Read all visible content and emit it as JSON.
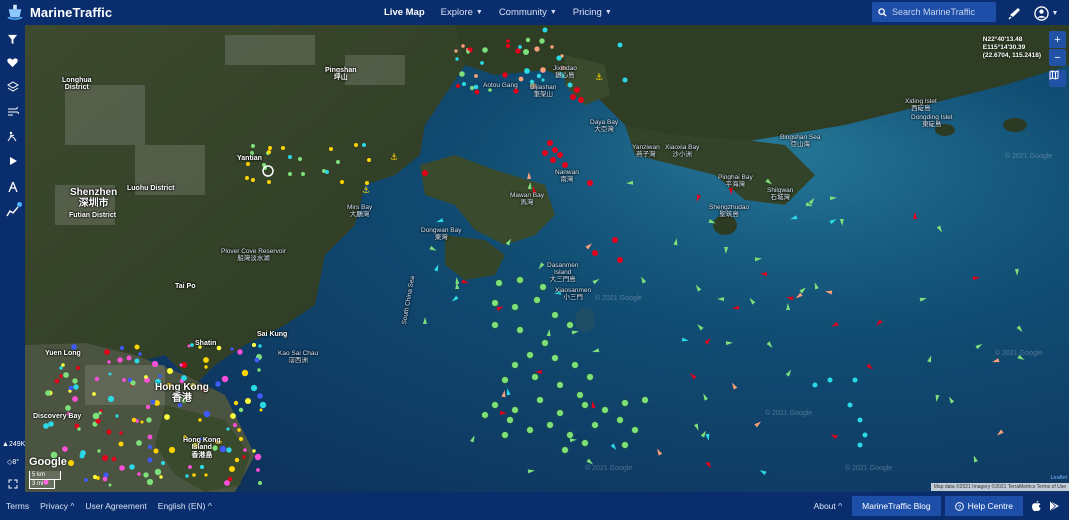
{
  "header": {
    "brand": "MarineTraffic",
    "nav": [
      {
        "label": "Live Map",
        "active": true
      },
      {
        "label": "Explore",
        "active": false
      },
      {
        "label": "Community",
        "active": false
      },
      {
        "label": "Pricing",
        "active": false
      }
    ],
    "search_placeholder": "Search MarineTraffic"
  },
  "sidebar": {
    "buttons": [
      "filter-icon",
      "heart-icon",
      "layers-icon",
      "weather-icon",
      "density-icon",
      "play-icon",
      "ruler-icon",
      "trend-icon"
    ],
    "vessel_count": "249K",
    "angle": "8°"
  },
  "map": {
    "coordinates": {
      "lat": "N22°40'13.48",
      "lon": "E115°14'30.39",
      "decimal": "(22.6704, 115.2418)"
    },
    "places": [
      {
        "name": "Shenzhen\n深圳市"
      },
      {
        "name": "Hong Kong\n香港"
      },
      {
        "name": "Hong Kong\nIsland\n香港島"
      },
      {
        "name": "Mirs Bay\n大鵬灣"
      },
      {
        "name": "Daya Bay\n大亞灣"
      },
      {
        "name": "Dasanmen\nIsland\n大三門島"
      },
      {
        "name": "Xiaosanmen\n小三門"
      },
      {
        "name": "Jixindao\n雞心島"
      },
      {
        "name": "Bijiashan\n筆架山"
      },
      {
        "name": "Nanwan\n南灣"
      },
      {
        "name": "Mawan Bay\n馬灣"
      },
      {
        "name": "Dongwan Bay\n東灣"
      },
      {
        "name": "Xiding Islet\n西碇島"
      },
      {
        "name": "Dongding Islet\n東碇島"
      },
      {
        "name": "Shengzhudao\n聖筑島"
      },
      {
        "name": "Pinghai Bay\n平海灣"
      },
      {
        "name": "Shilgwan\n石城灣"
      },
      {
        "name": "Bingshan Sea\n亞山海"
      },
      {
        "name": "Kao Sai Chau\n滘西洲"
      },
      {
        "name": "Plover Cove Reservoir\n船灣淡水湖"
      },
      {
        "name": "Yanziwan\n燕子灣"
      },
      {
        "name": "Xiaoxia Bay\n沙小洲"
      },
      {
        "name": "Pingshan\n坪山"
      },
      {
        "name": "Tai Po"
      },
      {
        "name": "Sai Kung"
      },
      {
        "name": "Longhua\nDistrict"
      },
      {
        "name": "Luohu District"
      },
      {
        "name": "Futian District"
      },
      {
        "name": "Yantian"
      },
      {
        "name": "Aotou Gang"
      },
      {
        "name": "South China Sea"
      },
      {
        "name": "Discovery Bay"
      },
      {
        "name": "Yuen Long"
      },
      {
        "name": "Shatin"
      }
    ],
    "watermark": "© 2021 Google",
    "google_logo": "Google",
    "scale_km": "5 km",
    "scale_mi": "3 mi",
    "attribution": "Map data ©2021 Imagery ©2021 TerraMetrics  Terms of Use",
    "leaflet": "Leaflet"
  },
  "footer": {
    "links_left": [
      "Terms",
      "Privacy ^",
      "User Agreement",
      "English (EN) ^"
    ],
    "about": "About ^",
    "blog": "MarineTraffic Blog",
    "help": "Help Centre"
  },
  "colors": {
    "nav_bg": "#0a2d6e",
    "accent": "#1e4fa8",
    "cargo": "#7ee07a",
    "tanker": "#e3001b",
    "passenger": "#2bd9e6",
    "fishing": "#ffa07a",
    "tug": "#ffd400",
    "pleasure": "#ff4fd8",
    "unknown": "#b0b0b0",
    "hsc": "#ffff3d"
  }
}
